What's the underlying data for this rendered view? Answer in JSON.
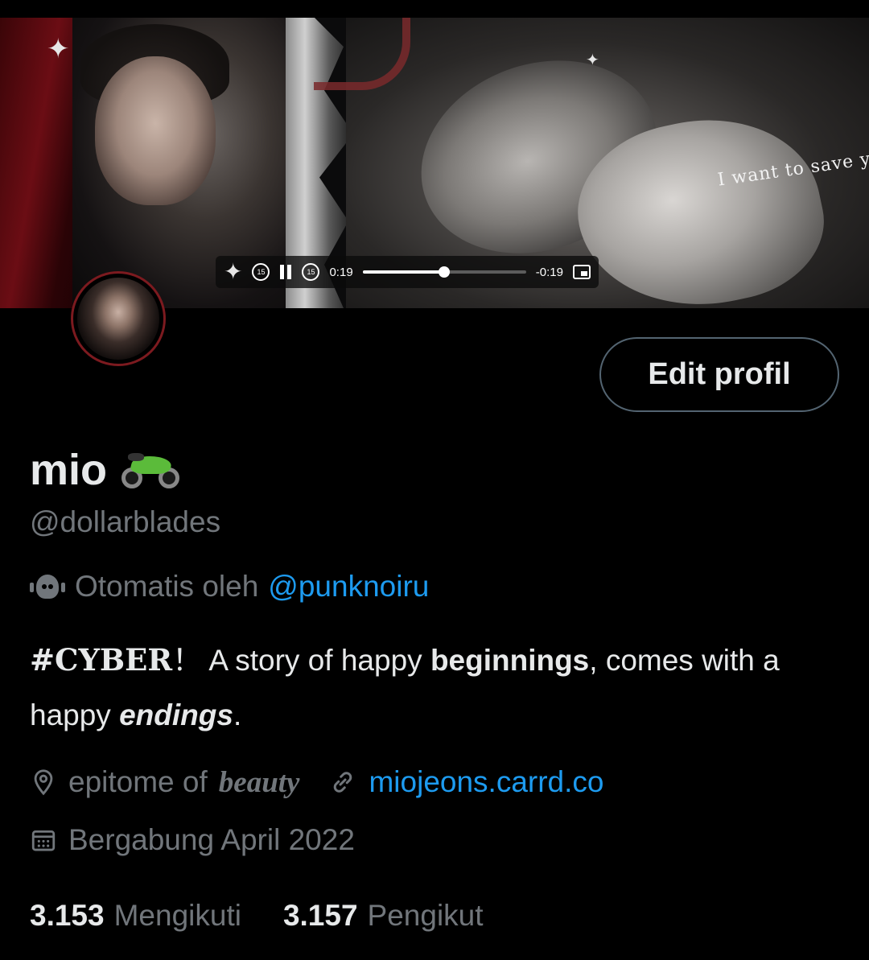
{
  "banner": {
    "overlay_text": "I want to save you from your own self",
    "video": {
      "elapsed": "0:19",
      "remaining": "-0:19",
      "progress_fraction": 0.5,
      "skip_back_label": "15",
      "skip_forward_label": "15"
    }
  },
  "profile": {
    "name": "mio",
    "name_emoji": "motorcycle-icon",
    "handle": "@dollarblades",
    "edit_button_label": "Edit profil",
    "automated": {
      "prefix": "Otomatis oleh",
      "account": "@punknoiru"
    },
    "bio": {
      "tag": "#CYBER",
      "exclaim": "！",
      "text1": " A story of happy ",
      "bold1": "beginnings",
      "text2": ", comes with a happy ",
      "bold2": "endings",
      "text3": "."
    },
    "location": {
      "prefix": "epitome of",
      "styled": "beauty"
    },
    "website": "miojeons.carrd.co",
    "joined": "Bergabung April 2022",
    "following": {
      "count": "3.153",
      "label": "Mengikuti"
    },
    "followers": {
      "count": "3.157",
      "label": "Pengikut"
    }
  },
  "colors": {
    "background": "#000000",
    "text": "#e7e9ea",
    "muted": "#71767b",
    "link": "#1d9bf0",
    "avatar_ring": "#7c1a1f"
  }
}
